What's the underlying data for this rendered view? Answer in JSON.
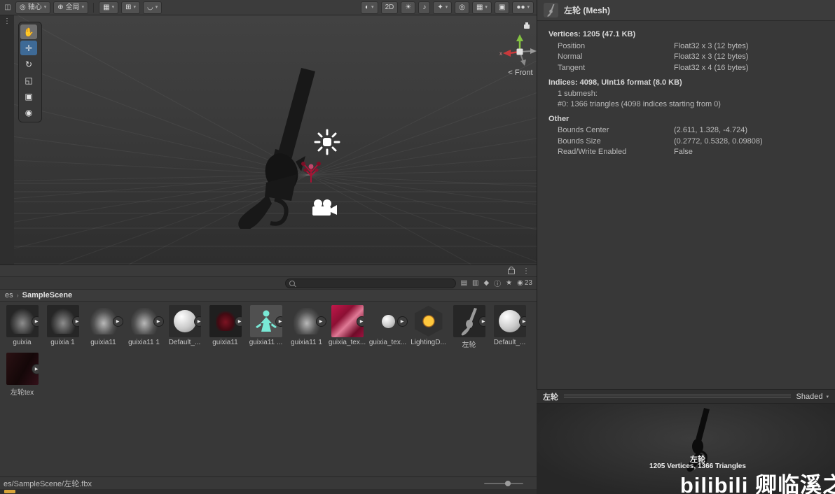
{
  "icons": {
    "window": "◫",
    "kebab": "⋮",
    "pivot": "◎",
    "globe": "⊕",
    "grid_snap": "▦",
    "axis_snap": "⊞",
    "magnet": "◡",
    "caret": "▾",
    "render_mode": "◐",
    "light": "☀",
    "audio": "♪",
    "effects": "✦",
    "visibility": "◎",
    "scene_grid": "▦",
    "camera_toggle": "▣",
    "hand": "✋",
    "move": "✛",
    "rotate": "↻",
    "scale": "◱",
    "rect": "▣",
    "transform": "◉",
    "play": "▶",
    "crumb_sep": "›",
    "eye": "◉",
    "filter_type": "▤",
    "filter_preview": "▥",
    "filter_tag": "◆",
    "info": "ⓘ",
    "star": "★"
  },
  "scene_toolbar": {
    "pivot": "轴心",
    "global": "全局",
    "two_d": "2D"
  },
  "scene": {
    "orientation": "< Front",
    "axis_x": "x"
  },
  "inspector": {
    "title": "左轮 (Mesh)",
    "vertices_header": "Vertices: 1205 (47.1 KB)",
    "rows": [
      {
        "label": "Position",
        "value": "Float32 x 3 (12 bytes)"
      },
      {
        "label": "Normal",
        "value": "Float32 x 3 (12 bytes)"
      },
      {
        "label": "Tangent",
        "value": "Float32 x 4 (16 bytes)"
      }
    ],
    "indices_header": "Indices: 4098, UInt16 format (8.0 KB)",
    "submesh_line": "1 submesh:",
    "submesh_detail": "#0: 1366 triangles (4098 indices starting from 0)",
    "other_header": "Other",
    "other_rows": [
      {
        "label": "Bounds Center",
        "value": "(2.611, 1.328, -4.724)"
      },
      {
        "label": "Bounds Size",
        "value": "(0.2772, 0.5328, 0.09808)"
      },
      {
        "label": "Read/Write Enabled",
        "value": "False"
      }
    ]
  },
  "project": {
    "hidden_count": "23",
    "breadcrumb": [
      "es",
      "SampleScene"
    ],
    "search_placeholder": "",
    "assets": [
      {
        "label": "guixia",
        "type": "smoke",
        "expand": true
      },
      {
        "label": "guixia 1",
        "type": "smoke",
        "expand": true
      },
      {
        "label": "guixia11",
        "type": "ghost",
        "expand": true
      },
      {
        "label": "guixia11 1",
        "type": "ghost",
        "expand": true
      },
      {
        "label": "Default_...",
        "type": "sphere",
        "expand": true
      },
      {
        "label": "guixia11",
        "type": "darkred",
        "expand": true
      },
      {
        "label": "guixia11 ...",
        "type": "cyan",
        "expand": true
      },
      {
        "label": "guixia11 1",
        "type": "ghost",
        "expand": true
      },
      {
        "label": "guixia_tex...",
        "type": "redtex",
        "expand": true
      },
      {
        "label": "guixia_tex...",
        "type": "minisphere",
        "expand": true
      },
      {
        "label": "LightingD...",
        "type": "lighting",
        "expand": false
      },
      {
        "label": "左轮",
        "type": "gun",
        "expand": true
      },
      {
        "label": "Default_...",
        "type": "sphere",
        "expand": true
      }
    ],
    "assets_row2": [
      {
        "label": "左轮tex",
        "type": "darktex",
        "expand": true
      }
    ]
  },
  "preview": {
    "title": "左轮",
    "mode": "Shaded",
    "model_label": "左轮",
    "stats": "1205 Vertices, 1366 Triangles"
  },
  "status": {
    "path": "es/SampleScene/左轮.fbx"
  },
  "watermark": "bilibili 卿临溪之"
}
